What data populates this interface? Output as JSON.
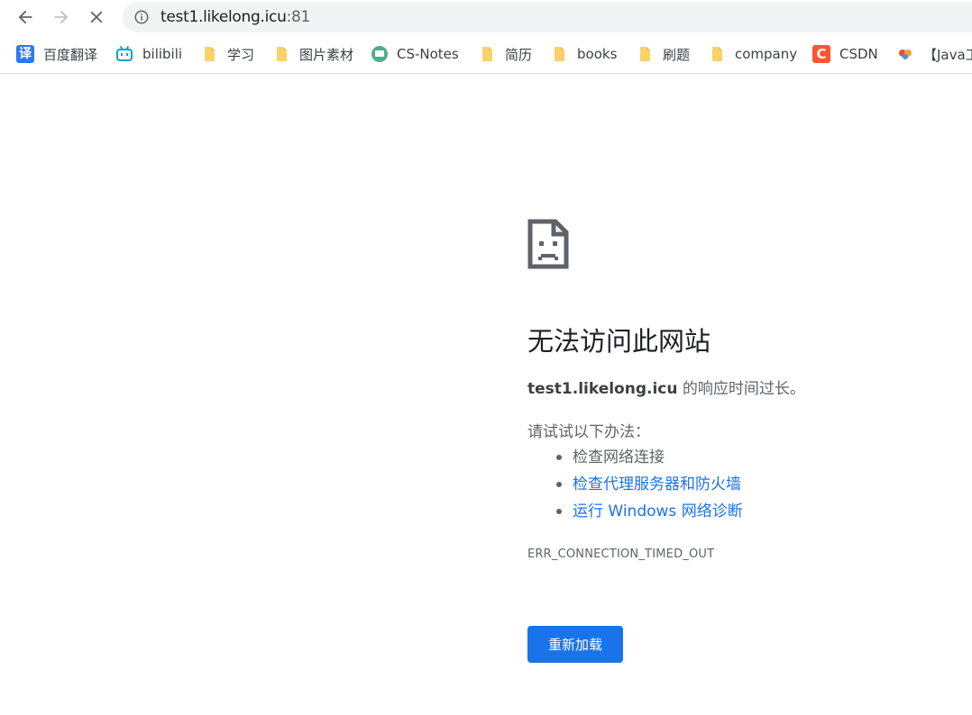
{
  "toolbar": {
    "back_icon": "arrow-back-icon",
    "forward_icon": "arrow-forward-icon",
    "stop_icon": "close-icon",
    "omnibox": {
      "site_info_icon": "info-icon",
      "url_host": "test1.likelong.icu",
      "url_port": ":81"
    }
  },
  "bookmarks": {
    "items": [
      {
        "label": "百度翻译",
        "icon": "baidu-fanyi-icon",
        "glyph": "译"
      },
      {
        "label": "bilibili",
        "icon": "bilibili-icon"
      },
      {
        "label": "学习",
        "icon": "folder-icon"
      },
      {
        "label": "图片素材",
        "icon": "folder-icon"
      },
      {
        "label": "CS-Notes",
        "icon": "cs-notes-icon"
      },
      {
        "label": "简历",
        "icon": "folder-icon"
      },
      {
        "label": "books",
        "icon": "folder-icon"
      },
      {
        "label": "刷题",
        "icon": "folder-icon"
      },
      {
        "label": "company",
        "icon": "folder-icon"
      },
      {
        "label": "CSDN",
        "icon": "csdn-icon",
        "glyph": "C"
      },
      {
        "label": "【Java工",
        "icon": "java-site-icon"
      }
    ]
  },
  "error": {
    "icon": "sad-page-icon",
    "title": "无法访问此网站",
    "host": "test1.likelong.icu",
    "message_suffix": " 的响应时间过长。",
    "try_label": "请试试以下办法：",
    "suggestions": [
      "检查网络连接",
      "检查代理服务器和防火墙",
      "运行 Windows 网络诊断"
    ],
    "error_code": "ERR_CONNECTION_TIMED_OUT",
    "reload_label": "重新加载"
  },
  "colors": {
    "link": "#1a73e8",
    "button": "#1a73e8",
    "folder": "#f9d26d",
    "text_secondary": "#5f6368"
  }
}
